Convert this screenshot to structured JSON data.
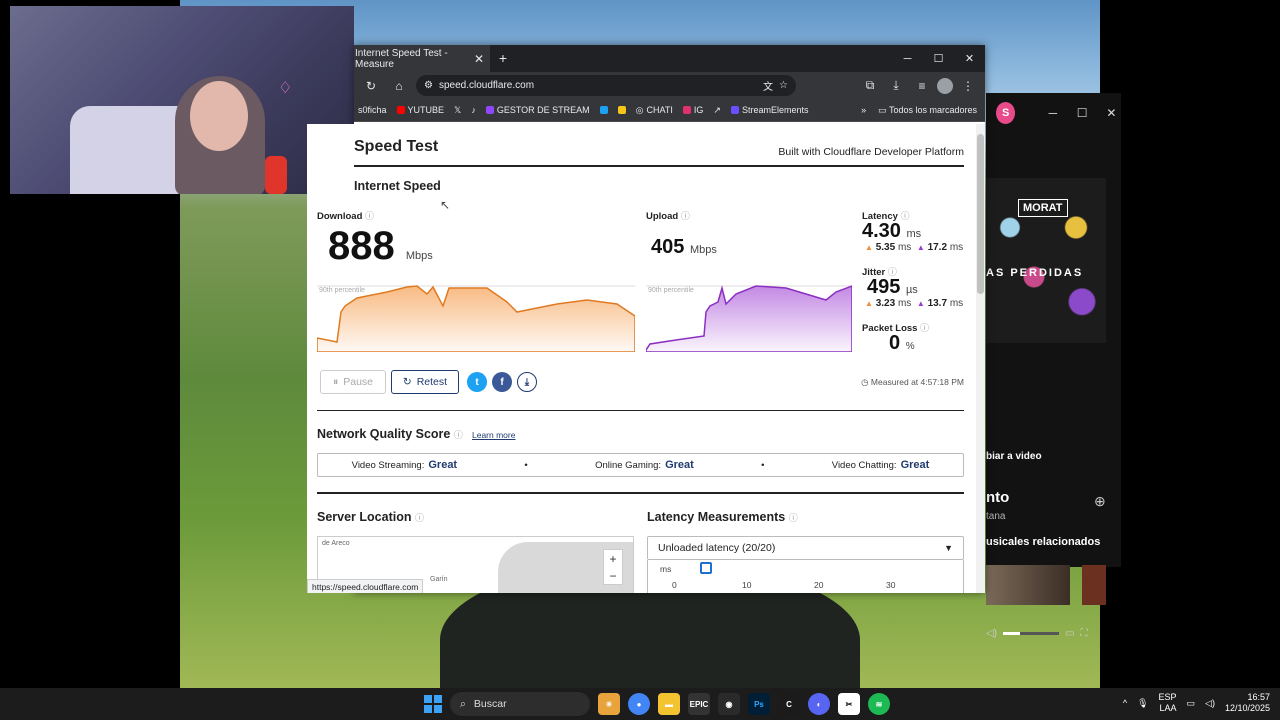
{
  "browser": {
    "tab_title": "Internet Speed Test - Measure",
    "url": "speed.cloudflare.com",
    "bookmarks": [
      "s0ficha",
      "YUTUBE",
      "GESTOR DE STREAM",
      "CHATI",
      "IG",
      "StreamElements"
    ],
    "all_bookmarks": "Todos los marcadores",
    "status_url": "https://speed.cloudflare.com"
  },
  "page": {
    "title": "Speed Test",
    "built_with": "Built with Cloudflare Developer Platform",
    "section": "Internet Speed",
    "download": {
      "label": "Download",
      "value": "888",
      "unit": "Mbps"
    },
    "upload": {
      "label": "Upload",
      "value": "405",
      "unit": "Mbps"
    },
    "percentile_label": "90th percentile",
    "latency": {
      "label": "Latency",
      "value": "4.30",
      "unit": "ms",
      "down": "5.35",
      "up": "17.2",
      "sub_unit": "ms"
    },
    "jitter": {
      "label": "Jitter",
      "value": "495",
      "unit": "µs",
      "down": "3.23",
      "up": "13.7",
      "sub_unit": "ms"
    },
    "packet_loss": {
      "label": "Packet Loss",
      "value": "0",
      "unit": "%"
    },
    "pause_label": "Pause",
    "retest_label": "Retest",
    "measured_at": "Measured at 4:57:18 PM",
    "nqs": {
      "title": "Network Quality Score",
      "learn_more": "Learn more",
      "items": [
        {
          "label": "Video Streaming:",
          "value": "Great"
        },
        {
          "label": "Online Gaming:",
          "value": "Great"
        },
        {
          "label": "Video Chatting:",
          "value": "Great"
        }
      ]
    },
    "server_location": "Server Location",
    "map_labels": [
      "de Areco",
      "Garín"
    ],
    "latency_measurements": "Latency Measurements",
    "unloaded_latency": "Unloaded latency (20/20)",
    "latency_axis": {
      "unit": "ms",
      "ticks": [
        "0",
        "10",
        "20",
        "30"
      ]
    }
  },
  "spotify": {
    "avatar": "S",
    "album_band": "MORAT",
    "album_title": "AS PERDIDAS",
    "video_button": "biar a video",
    "track_title": "nto",
    "artist": "tana",
    "related": "usicales relacionados"
  },
  "taskbar": {
    "search": "Buscar",
    "lang": "ESP",
    "lang2": "LAA",
    "time": "16:57",
    "date": "12/10/2025"
  }
}
